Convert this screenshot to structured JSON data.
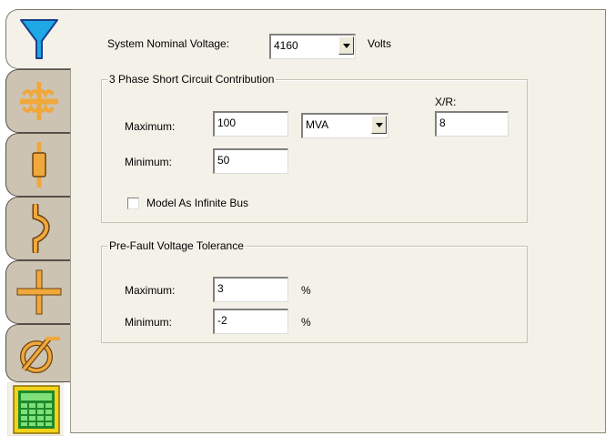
{
  "tabs": [
    {
      "icon": "filter-icon",
      "active": true
    },
    {
      "icon": "transformer-icon",
      "active": false
    },
    {
      "icon": "fuse-icon",
      "active": false
    },
    {
      "icon": "cable-icon",
      "active": false
    },
    {
      "icon": "bus-icon",
      "active": false
    },
    {
      "icon": "motor-icon",
      "active": false
    },
    {
      "icon": "calculator-icon",
      "active": false
    }
  ],
  "system": {
    "voltage_label": "System Nominal Voltage:",
    "voltage_value": "4160",
    "voltage_unit": "Volts"
  },
  "short_circuit": {
    "title": "3 Phase Short Circuit Contribution",
    "maximum_label": "Maximum:",
    "maximum_value": "100",
    "unit_value": "MVA",
    "minimum_label": "Minimum:",
    "minimum_value": "50",
    "xr_label": "X/R:",
    "xr_value": "8",
    "infinite_bus_label": "Model As Infinite Bus",
    "infinite_bus_checked": false
  },
  "prefault": {
    "title": "Pre-Fault Voltage Tolerance",
    "maximum_label": "Maximum:",
    "maximum_value": "3",
    "maximum_unit": "%",
    "minimum_label": "Minimum:",
    "minimum_value": "-2",
    "minimum_unit": "%"
  },
  "colors": {
    "panel": "#f4f1e8",
    "tab_inactive": "#cdc3b2",
    "icon_orange": "#f0a83c",
    "filter_blue": "#1ea8e6",
    "calc_green": "#2fbf3a"
  }
}
